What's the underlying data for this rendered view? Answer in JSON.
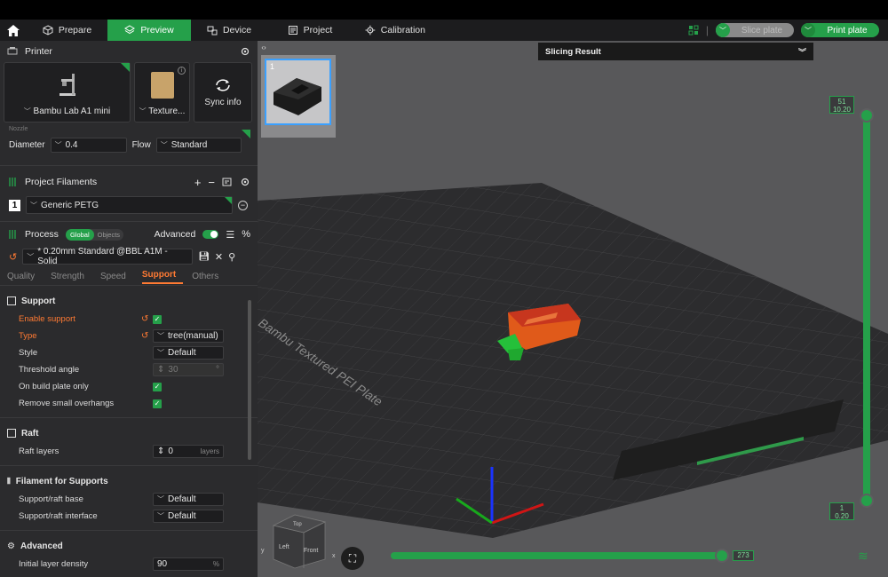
{
  "menubar": {
    "tabs": [
      {
        "label": "Prepare",
        "icon": "cube-icon"
      },
      {
        "label": "Preview",
        "icon": "layers-icon"
      },
      {
        "label": "Device",
        "icon": "device-icon"
      },
      {
        "label": "Project",
        "icon": "project-icon"
      },
      {
        "label": "Calibration",
        "icon": "gear-icon"
      }
    ],
    "slice_label": "Slice plate",
    "print_label": "Print plate",
    "accent": "#25a04a"
  },
  "printer": {
    "title": "Printer",
    "printer_name": "Bambu Lab A1 mini",
    "plate_name": "Texture...",
    "sync_label": "Sync info",
    "nozzle_label": "Nozzle",
    "diameter_label": "Diameter",
    "diameter_value": "0.4",
    "flow_label": "Flow",
    "flow_value": "Standard"
  },
  "filaments": {
    "title": "Project Filaments",
    "items": [
      {
        "index": "1",
        "name": "Generic PETG"
      }
    ]
  },
  "process": {
    "title": "Process",
    "toggle_global": "Global",
    "toggle_objects": "Objects",
    "advanced_label": "Advanced",
    "preset": "* 0.20mm Standard @BBL A1M - Solid",
    "subtabs": [
      "Quality",
      "Strength",
      "Speed",
      "Support",
      "Others"
    ],
    "active_subtab": "Support"
  },
  "support": {
    "title": "Support",
    "enable_support": "Enable support",
    "type_label": "Type",
    "type_value": "tree(manual)",
    "style_label": "Style",
    "style_value": "Default",
    "threshold_label": "Threshold angle",
    "threshold_value": "30",
    "threshold_unit": "°",
    "build_plate_only": "On build plate only",
    "remove_small": "Remove small overhangs"
  },
  "raft": {
    "title": "Raft",
    "layers_label": "Raft layers",
    "layers_value": "0",
    "layers_unit": "layers"
  },
  "filament_supports": {
    "title": "Filament for Supports",
    "base_label": "Support/raft base",
    "base_value": "Default",
    "interface_label": "Support/raft interface",
    "interface_value": "Default"
  },
  "advanced": {
    "title": "Advanced",
    "density_label": "Initial layer density",
    "density_value": "90",
    "density_unit": "%"
  },
  "viewport": {
    "plate_number": "1",
    "slicing_result": "Slicing Result",
    "top_layer": "51",
    "top_height": "10.20",
    "bottom_layer": "1",
    "bottom_height": "0.20",
    "move_count": "273",
    "plate_text": "Bambu Textured PEI Plate",
    "cube_top": "Top",
    "cube_left": "Left",
    "cube_front": "Front",
    "axis_x": "x",
    "axis_y": "y"
  }
}
